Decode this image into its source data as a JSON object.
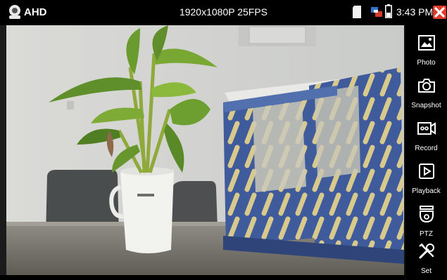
{
  "status_bar": {
    "signal_type": "AHD",
    "resolution_fps": "1920x1080P 25FPS",
    "time": "3:43 PM"
  },
  "sidebar": {
    "items": [
      {
        "label": "Photo",
        "icon": "photo-icon"
      },
      {
        "label": "Snapshot",
        "icon": "camera-icon"
      },
      {
        "label": "Record",
        "icon": "video-record-icon"
      },
      {
        "label": "Playback",
        "icon": "play-icon"
      },
      {
        "label": "PTZ",
        "icon": "ptz-dome-camera-icon"
      },
      {
        "label": "Set",
        "icon": "tools-icon"
      }
    ]
  },
  "colors": {
    "close_button": "#e13b2b",
    "bar_background": "#000000",
    "organizer_blue": "#3e5a9a"
  }
}
